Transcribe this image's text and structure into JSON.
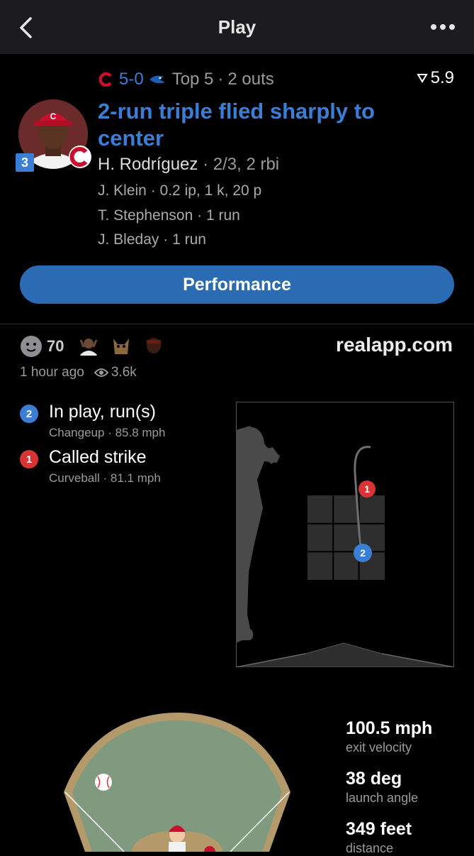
{
  "nav": {
    "title": "Play",
    "back_icon": "chevron-left-icon",
    "more_icon": "ellipsis-icon"
  },
  "game": {
    "score": "5-0",
    "inning": "Top 5",
    "outs": "2 outs",
    "leverage": "5.9",
    "away_logo": "reds-c-logo",
    "home_logo": "blue-jays-logo"
  },
  "play": {
    "title": "2-run triple flied sharply to center",
    "batter_name": "H. Rodríguez",
    "batter_line": "2/3, 2 rbi",
    "batting_order": "3",
    "pitcher_name": "J. Klein",
    "pitcher_line": "0.2 ip, 1 k, 20 p",
    "runner1_name": "T. Stephenson",
    "runner1_line": "1 run",
    "runner2_name": "J. Bleday",
    "runner2_line": "1 run",
    "performance_label": "Performance"
  },
  "social": {
    "reaction_count": "70",
    "domain": "realapp.com",
    "time_ago": "1 hour ago",
    "views": "3.6k"
  },
  "pitches": [
    {
      "num": "2",
      "result": "In play, run(s)",
      "type": "Changeup",
      "speed": "85.8 mph",
      "color": "#3a7fd5"
    },
    {
      "num": "1",
      "result": "Called strike",
      "type": "Curveball",
      "speed": "81.1 mph",
      "color": "#d93434"
    }
  ],
  "batted_ball": {
    "exit_velocity_value": "100.5 mph",
    "exit_velocity_label": "exit velocity",
    "launch_angle_value": "38 deg",
    "launch_angle_label": "launch angle",
    "distance_value": "349 feet",
    "distance_label": "distance"
  },
  "colors": {
    "accent_blue": "#3a7fd5",
    "strike_red": "#d93434",
    "button_blue": "#2a6bb3",
    "infield_tan": "#b49a6a",
    "outfield_green": "#7f9a7e"
  }
}
